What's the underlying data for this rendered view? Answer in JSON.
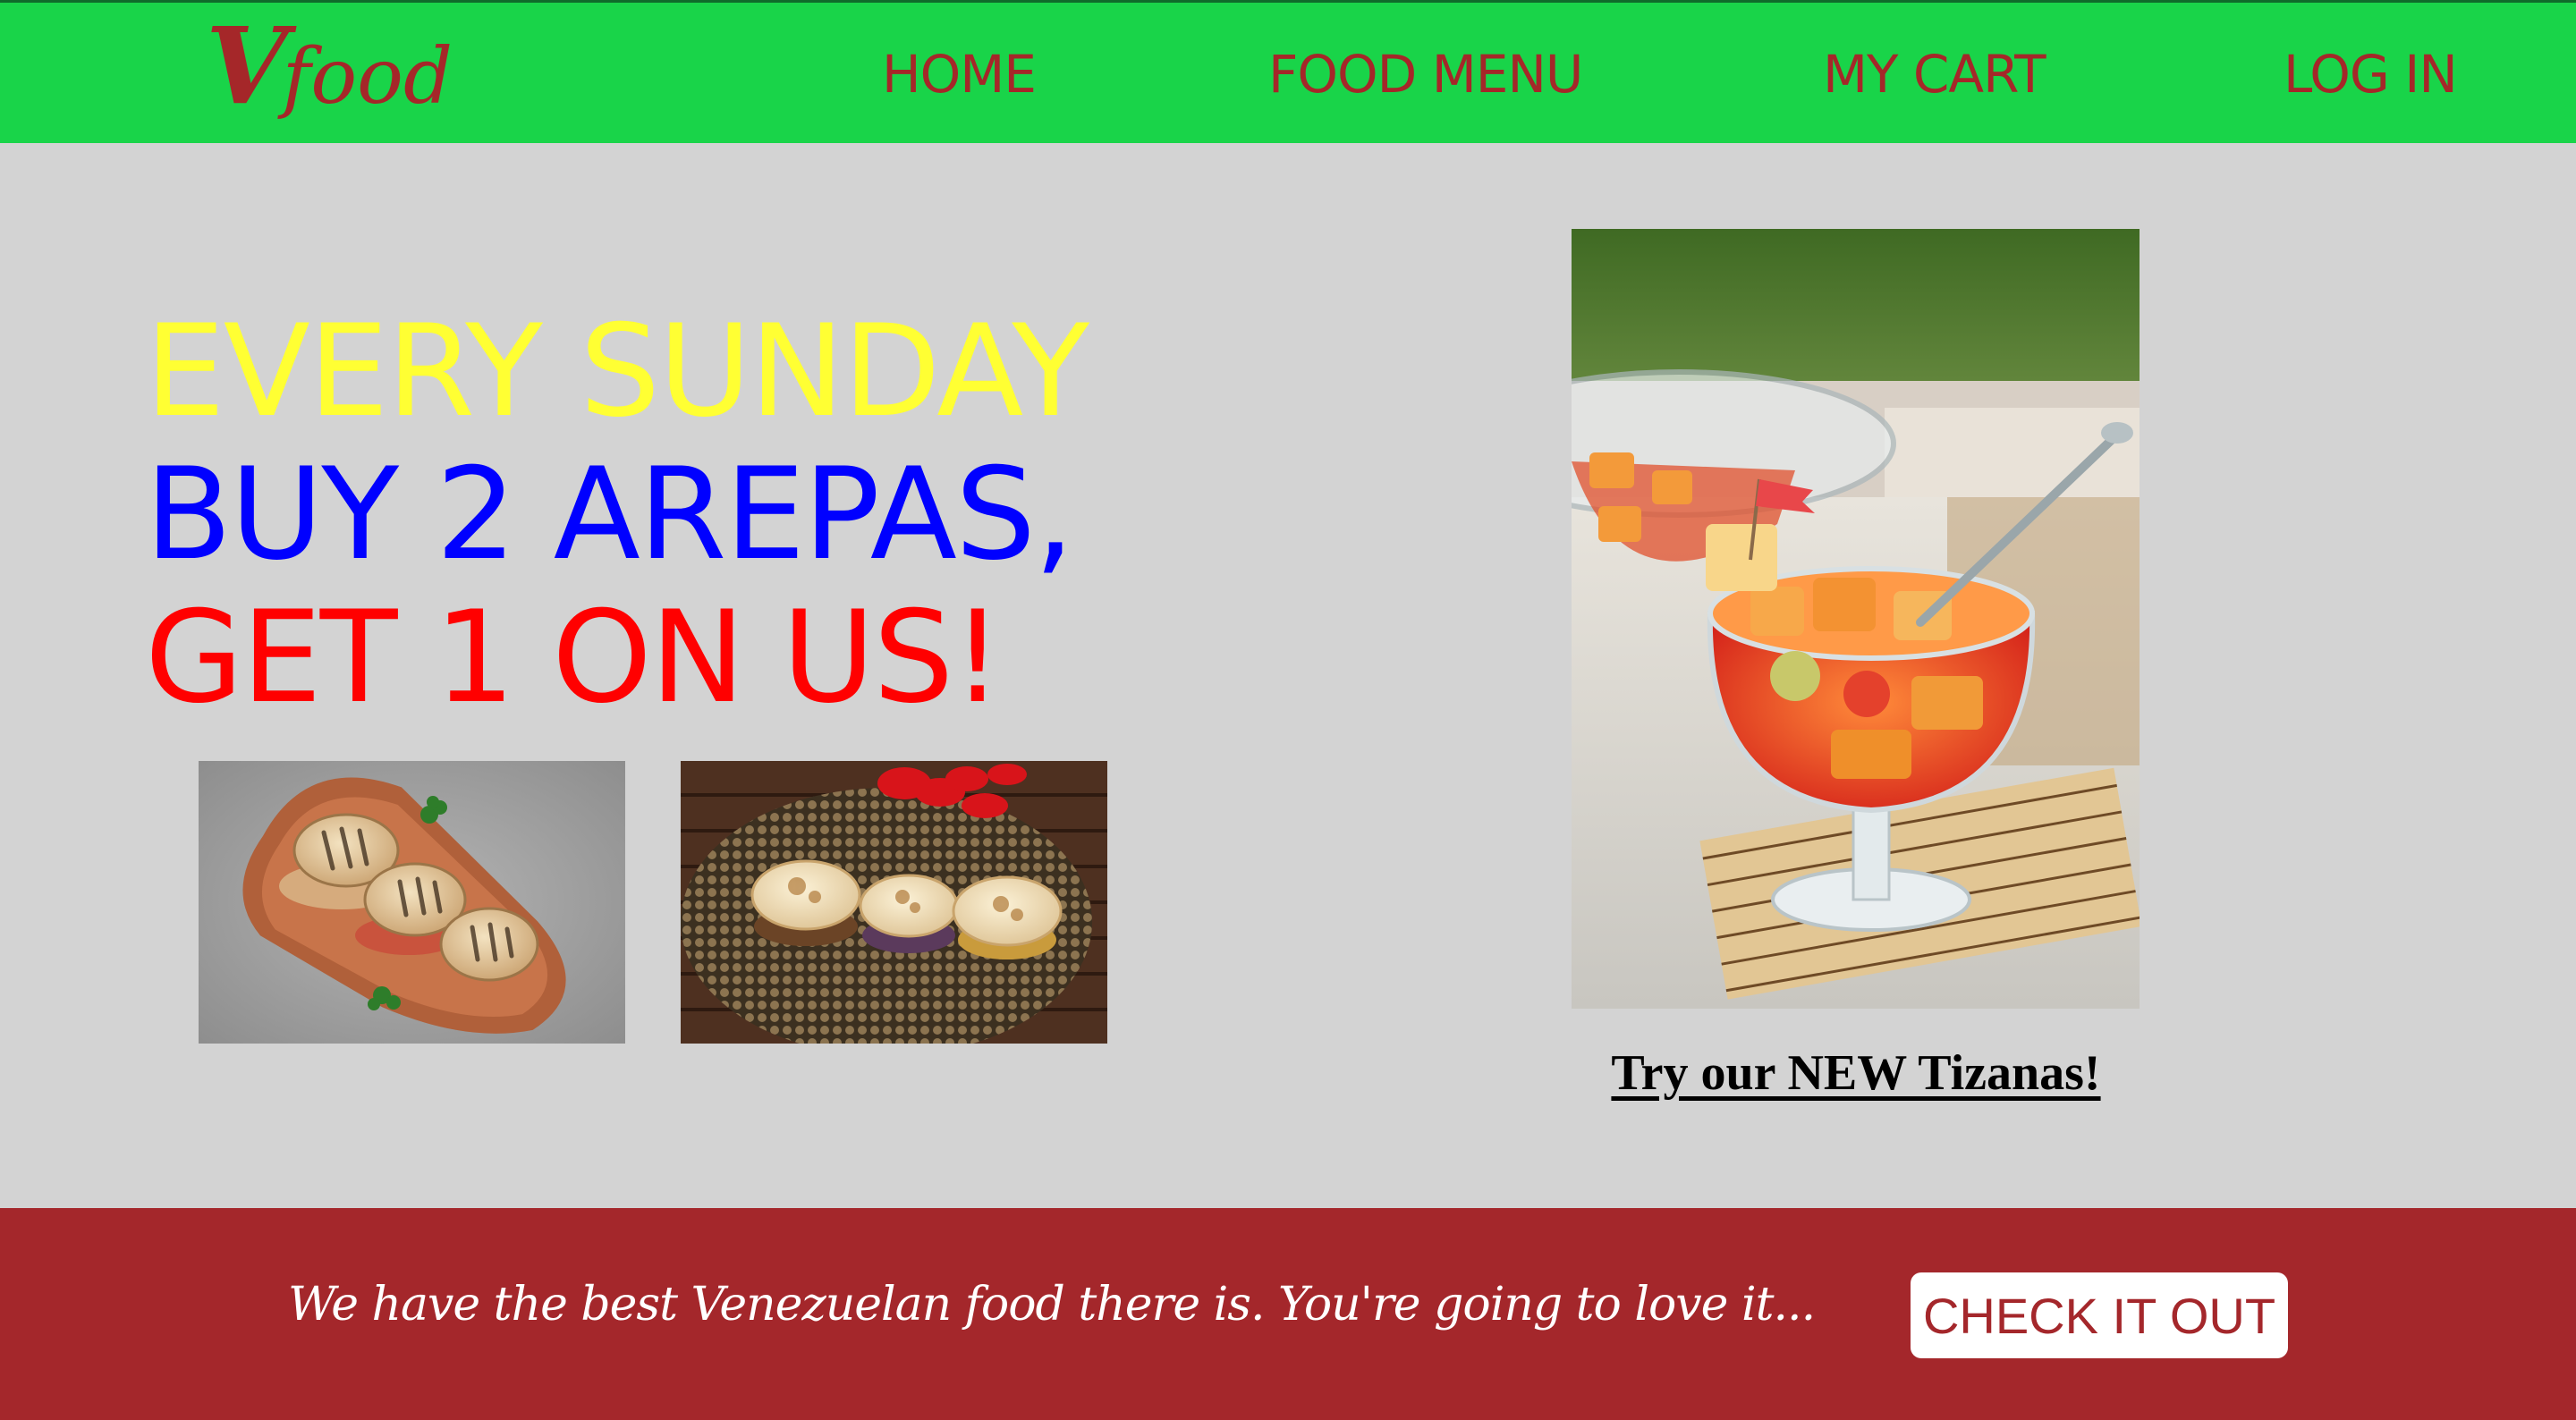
{
  "nav": {
    "logo_v": "V",
    "logo_rest": "food",
    "home": "HOME",
    "food_menu": "FOOD MENU",
    "my_cart": "MY CART",
    "log_in": "LOG IN"
  },
  "promo": {
    "line1": "EVERY SUNDAY",
    "line2": "BUY 2 AREPAS,",
    "line3": "GET 1 ON US!"
  },
  "images": {
    "arepa_1": "arepas on wooden board",
    "arepa_2": "arepas on woven placemat",
    "tizana": "tizana fruit drink"
  },
  "tizana_link": "Try our NEW Tizanas!",
  "footer": {
    "tagline": "We have the best Venezuelan food there is. You're going to love it...",
    "button": "CHECK IT OUT"
  },
  "colors": {
    "nav_bg": "#19d449",
    "nav_text": "#a52729",
    "page_bg": "#d3d3d3",
    "promo_yellow": "#ffff33",
    "promo_blue": "#0000ff",
    "promo_red": "#ff0000",
    "footer_bg": "#a4272b"
  }
}
